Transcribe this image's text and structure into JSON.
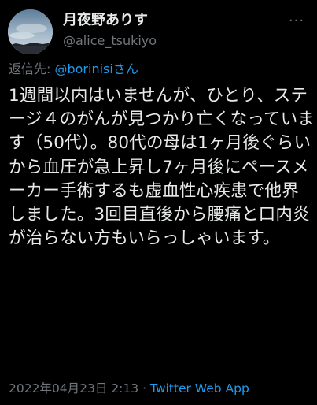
{
  "author": {
    "display_name": "月夜野ありす",
    "handle": "@alice_tsukiyo",
    "avatar_icon": "avatar-sky-photo"
  },
  "header": {
    "more_icon": "more-options-icon",
    "more_label": "···"
  },
  "reply": {
    "prefix": "返信先: ",
    "mention": "@borinisiさん"
  },
  "tweet": {
    "text": "1週間以内はいませんが、ひとり、ステージ４のがんが見つかり亡くなっています（50代）。80代の母は1ヶ月後ぐらいから血圧が急上昇し7ヶ月後にペースメーカー手術するも虚血性心疾患で他界しました。3回目直後から腰痛と口内炎が治らない方もいらっしゃいます。"
  },
  "meta": {
    "timestamp": "2022年04月23日 2:13",
    "separator": " · ",
    "source": "Twitter Web App"
  },
  "colors": {
    "background": "#000000",
    "text": "#e7e9ea",
    "secondary": "#71767b",
    "accent": "#1d9bf0"
  }
}
